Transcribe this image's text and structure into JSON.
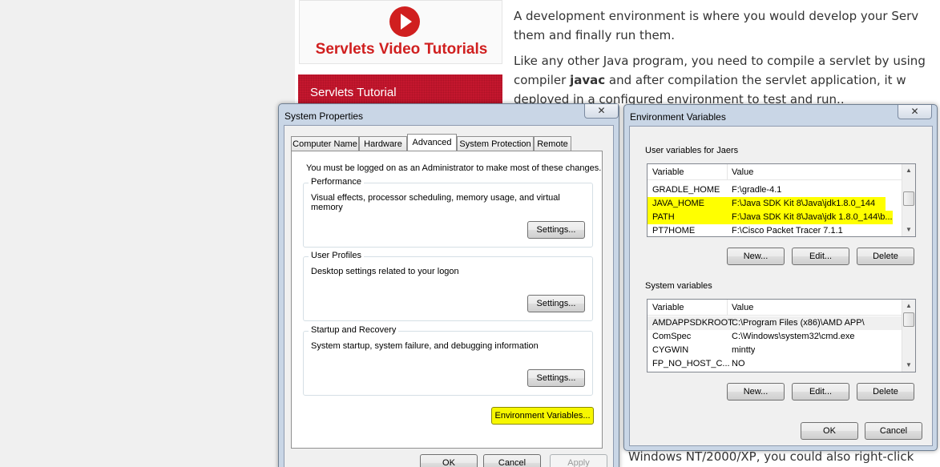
{
  "webpage": {
    "banner_title": "Servlets Video Tutorials",
    "menu_item": "Servlets Tutorial",
    "paragraph1_line1": "A development environment is where you would develop your Serv",
    "paragraph1_line2": "them and finally run them.",
    "paragraph2_line1": "Like any other Java program, you need to compile a servlet by using",
    "paragraph2_line2_pre": "compiler ",
    "paragraph2_line2_bold": "javac",
    "paragraph2_line2_post": " and after compilation the servlet application, it w",
    "paragraph2_line3": "deployed in a configured environment to test and run..",
    "bottom_line": "Windows NT/2000/XP, you could also right-click"
  },
  "system_properties": {
    "title": "System Properties",
    "close_glyph": "✕",
    "tabs": [
      "Computer Name",
      "Hardware",
      "Advanced",
      "System Protection",
      "Remote"
    ],
    "active_tab": "Advanced",
    "admin_notice": "You must be logged on as an Administrator to make most of these changes.",
    "performance": {
      "label": "Performance",
      "desc": "Visual effects, processor scheduling, memory usage, and virtual memory",
      "button": "Settings..."
    },
    "user_profiles": {
      "label": "User Profiles",
      "desc": "Desktop settings related to your logon",
      "button": "Settings..."
    },
    "startup_recovery": {
      "label": "Startup and Recovery",
      "desc": "System startup, system failure, and debugging information",
      "button": "Settings..."
    },
    "env_button": "Environment Variables...",
    "ok": "OK",
    "cancel": "Cancel",
    "apply": "Apply"
  },
  "environment_variables": {
    "title": "Environment Variables",
    "close_glyph": "✕",
    "user_section_label": "User variables for Jaers",
    "system_section_label": "System variables",
    "columns": {
      "variable": "Variable",
      "value": "Value"
    },
    "user_rows": [
      {
        "variable": "GRADLE_HOME",
        "value": "F:\\gradle-4.1"
      },
      {
        "variable": "JAVA_HOME",
        "value": "F:\\Java SDK Kit 8\\Java\\jdk1.8.0_144"
      },
      {
        "variable": "PATH",
        "value": "F:\\Java SDK Kit 8\\Java\\jdk 1.8.0_144\\b..."
      },
      {
        "variable": "PT7HOME",
        "value": "F:\\Cisco Packet Tracer 7.1.1"
      }
    ],
    "system_rows": [
      {
        "variable": "AMDAPPSDKROOT",
        "value": "C:\\Program Files (x86)\\AMD APP\\"
      },
      {
        "variable": "ComSpec",
        "value": "C:\\Windows\\system32\\cmd.exe"
      },
      {
        "variable": "CYGWIN",
        "value": "mintty"
      },
      {
        "variable": "FP_NO_HOST_C...",
        "value": "NO"
      }
    ],
    "new_button": "New...",
    "edit_button": "Edit...",
    "delete_button": "Delete",
    "ok": "OK",
    "cancel": "Cancel"
  }
}
